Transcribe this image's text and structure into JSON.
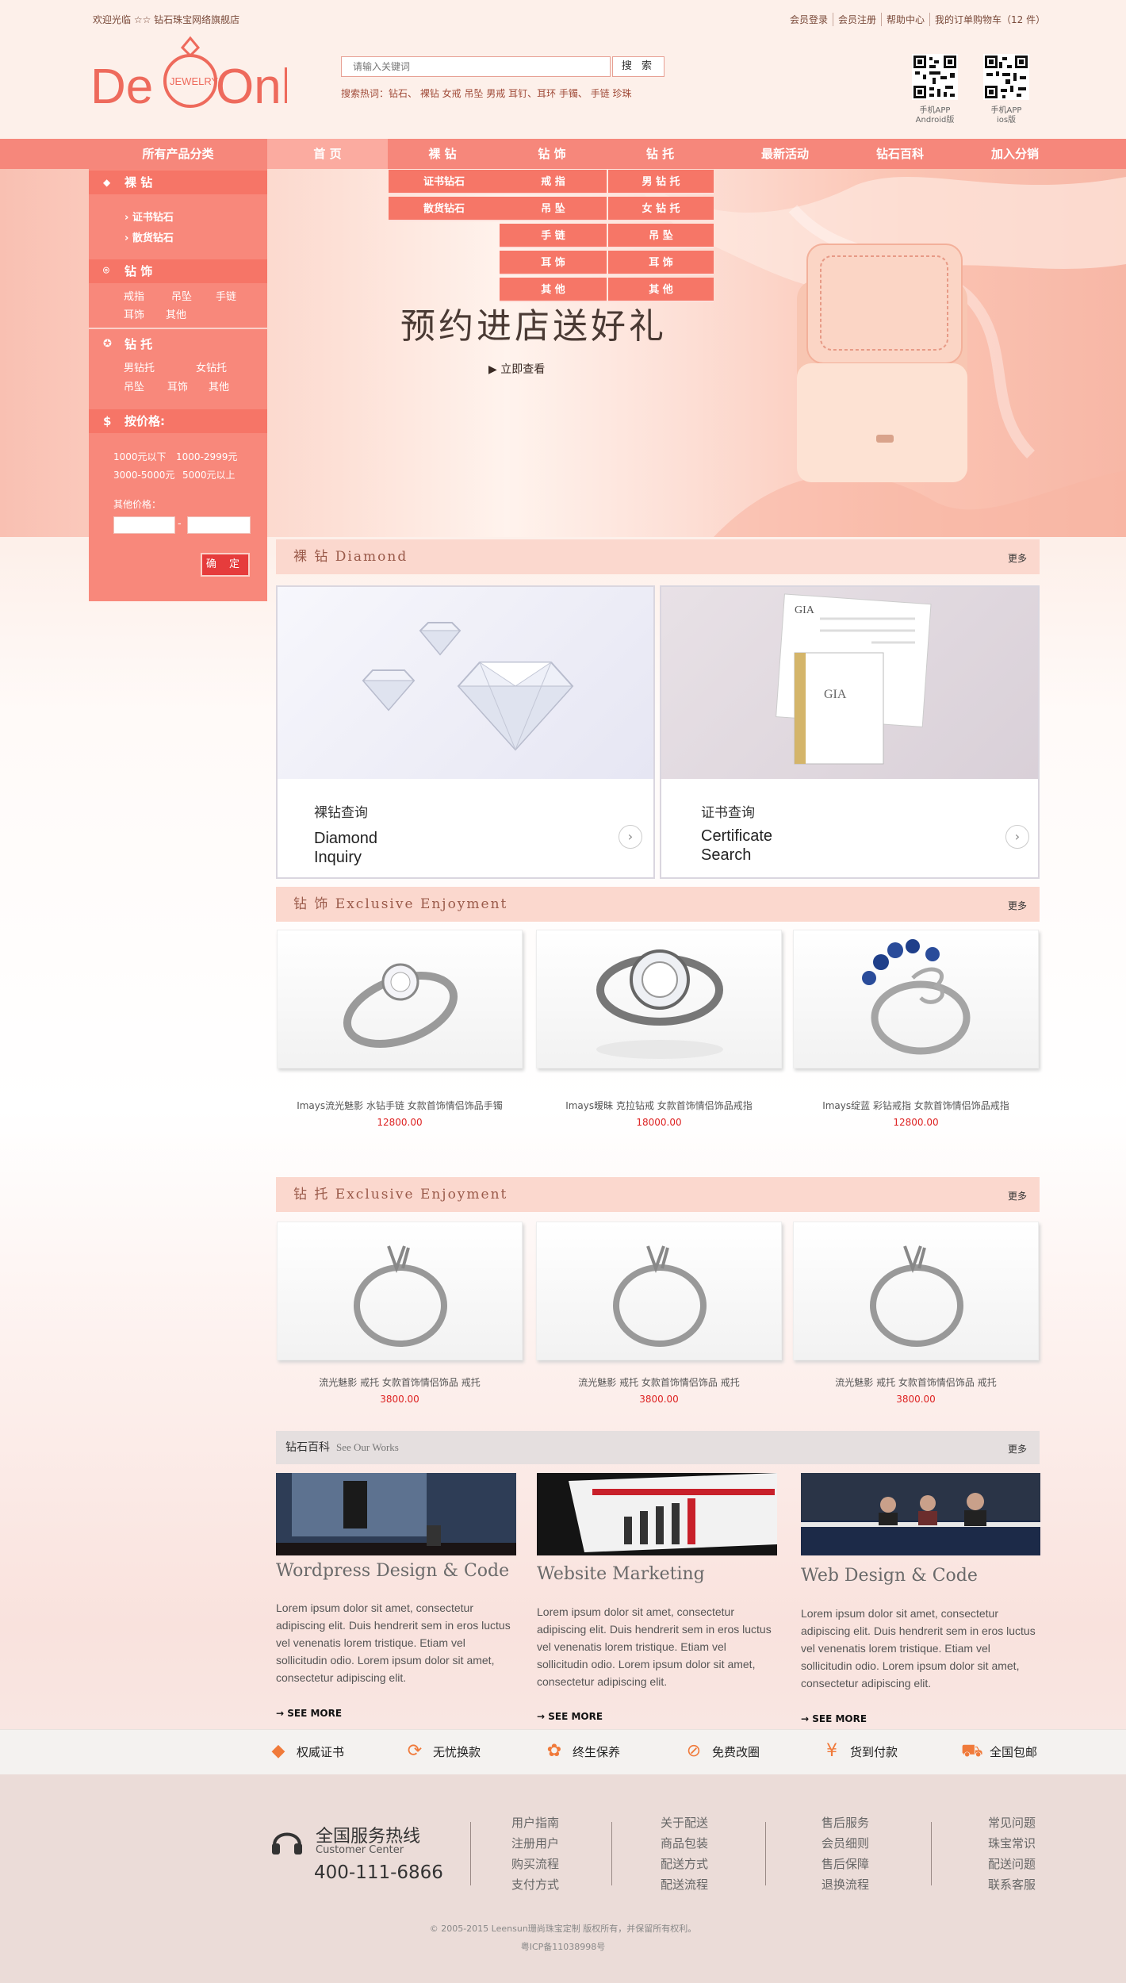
{
  "topbar": {
    "welcome": "欢迎光临 ☆☆ 钻石珠宝网络旗舰店",
    "links": [
      "会员登录",
      "会员注册",
      "帮助中心",
      "我的订单购物车（12 件）"
    ]
  },
  "logo": {
    "text_de": "De",
    "text_only": "Only",
    "text_jewelry": "JEWELRY"
  },
  "search": {
    "placeholder": "请输入关键词",
    "button": "搜 索",
    "hot_label": "搜索热词：",
    "hot_words": "钻石、 裸钻  女戒  吊坠  男戒  耳钉、耳环  手镯、 手链  珍珠"
  },
  "apps": [
    {
      "label1": "手机APP",
      "label2": "Android版"
    },
    {
      "label1": "手机APP",
      "label2": "ios版"
    }
  ],
  "nav": {
    "all": "所有产品分类",
    "items": [
      "首 页",
      "裸 钻",
      "钻 饰",
      "钻 托",
      "最新活动",
      "钻石百科",
      "加入分销"
    ]
  },
  "dropdowns": {
    "luozuan": [
      "证书钻石",
      "散货钻石"
    ],
    "zuanshi": [
      "戒 指",
      "吊 坠",
      "手 链",
      "耳 饰",
      "其 他"
    ],
    "zuantuo": [
      "男 钻 托",
      "女 钻 托",
      "吊 坠",
      "耳 饰",
      "其 他"
    ]
  },
  "banner": {
    "headline": "预约进店送好礼",
    "cta": "▶ 立即查看"
  },
  "sidebar": {
    "s1_title": "裸 钻",
    "s1_links": [
      "› 证书钻石",
      "› 散货钻石"
    ],
    "s2_title": "钻 饰",
    "s2_links": [
      "戒指",
      "吊坠",
      "手链",
      "耳饰",
      "其他"
    ],
    "s3_title": "钻 托",
    "s3_links": [
      "男钻托",
      "女钻托",
      "吊坠",
      "耳饰",
      "其他"
    ],
    "s4_title": "按价格:",
    "price_ranges": [
      "1000元以下",
      "1000-2999元",
      "3000-5000元",
      "5000元以上"
    ],
    "other_price": "其他价格：",
    "dash": "-",
    "confirm": "确 定"
  },
  "sections": {
    "diamond": {
      "title": "裸 钻  Diamond",
      "more": "更多"
    },
    "jewelry": {
      "title": "钻 饰  Exclusive Enjoyment",
      "more": "更多"
    },
    "mount": {
      "title": "钻 托  Exclusive Enjoyment",
      "more": "更多"
    },
    "wiki": {
      "title": "钻石百科",
      "subtitle": "See Our Works",
      "more": "更多"
    }
  },
  "diamond_cards": [
    {
      "cn": "裸钻查询",
      "en1": "Diamond",
      "en2": "Inquiry"
    },
    {
      "cn": "证书查询",
      "en1": "Certificate",
      "en2": "Search"
    }
  ],
  "gia": {
    "logo": "GIA"
  },
  "jewelry_products": [
    {
      "name": "Imays流光魅影 水钻手链 女款首饰情侣饰品手镯",
      "price": "12800.00"
    },
    {
      "name": "Imays暧昧 克拉钻戒 女款首饰情侣饰品戒指",
      "price": "18000.00"
    },
    {
      "name": "Imays绽蓝 彩钻戒指 女款首饰情侣饰品戒指",
      "price": "12800.00"
    }
  ],
  "mount_products": [
    {
      "name": "流光魅影  戒托 女款首饰情侣饰品 戒托",
      "price": "3800.00"
    },
    {
      "name": "流光魅影  戒托 女款首饰情侣饰品 戒托",
      "price": "3800.00"
    },
    {
      "name": "流光魅影  戒托 女款首饰情侣饰品 戒托",
      "price": "3800.00"
    }
  ],
  "blog": [
    {
      "title": "Wordpress Design & Code",
      "text": "Lorem ipsum dolor sit amet, consectetur adipiscing elit. Duis hendrerit sem in eros luctus vel venenatis lorem tristique. Etiam vel sollicitudin odio. Lorem ipsum dolor sit amet, consectetur adipiscing elit.",
      "more": "SEE MORE"
    },
    {
      "title": "Website Marketing",
      "text": "Lorem ipsum dolor sit amet, consectetur adipiscing elit. Duis hendrerit sem in eros luctus vel venenatis lorem tristique. Etiam vel sollicitudin odio. Lorem ipsum dolor sit amet, consectetur adipiscing elit.",
      "more": "SEE MORE"
    },
    {
      "title": "Web Design & Code",
      "text": "Lorem ipsum dolor sit amet, consectetur adipiscing elit. Duis hendrerit sem in eros luctus vel venenatis lorem tristique. Etiam vel sollicitudin odio. Lorem ipsum dolor sit amet, consectetur adipiscing elit.",
      "more": "SEE MORE"
    }
  ],
  "features": [
    {
      "label": "权威证书",
      "icon": "diamond-icon"
    },
    {
      "label": "无忧换款",
      "icon": "exchange-icon"
    },
    {
      "label": "终生保养",
      "icon": "flower-icon"
    },
    {
      "label": "免费改圈",
      "icon": "ring-size-icon"
    },
    {
      "label": "货到付款",
      "icon": "cash-on-delivery-icon"
    },
    {
      "label": "全国包邮",
      "icon": "free-shipping-icon"
    }
  ],
  "footer": {
    "hotline_title": "全国服务热线",
    "hotline_sub": "Customer Center",
    "phone": "400-111-6866",
    "col1": [
      "用户指南",
      "注册用户",
      "购买流程",
      "支付方式"
    ],
    "col2": [
      "关于配送",
      "商品包装",
      "配送方式",
      "配送流程"
    ],
    "col3": [
      "售后服务",
      "会员细则",
      "售后保障",
      "退换流程"
    ],
    "col4": [
      "常见问题",
      "珠宝常识",
      "配送问题",
      "联系客服"
    ],
    "copyright": "© 2005-2015 Leensun珊尚珠宝定制 版权所有，并保留所有权利。",
    "icp": "粤ICP备11038998号"
  },
  "colors": {
    "accent": "#f6877b",
    "accent_dark": "#f67567",
    "price": "#dd2222"
  }
}
